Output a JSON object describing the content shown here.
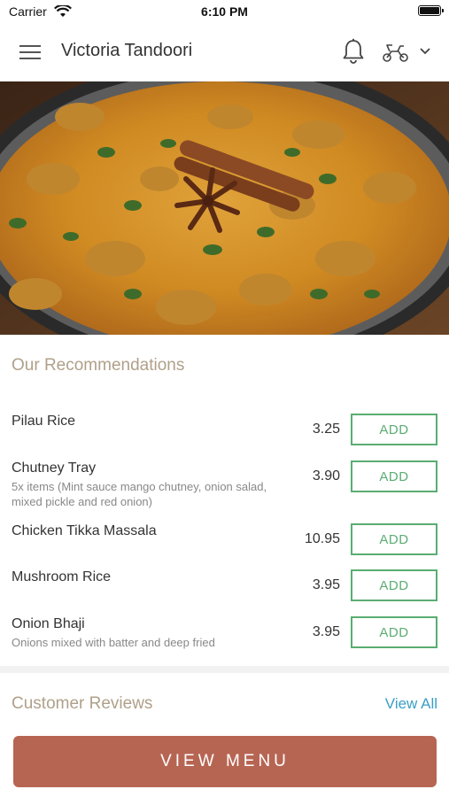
{
  "status_bar": {
    "carrier": "Carrier",
    "time": "6:10 PM"
  },
  "nav": {
    "title": "Victoria Tandoori"
  },
  "recommendations": {
    "title": "Our Recommendations",
    "add_label": "ADD",
    "items": [
      {
        "name": "Pilau Rice",
        "description": "",
        "price": "3.25"
      },
      {
        "name": "Chutney Tray",
        "description": "5x items (Mint sauce mango chutney, onion salad, mixed pickle and red onion)",
        "price": "3.90"
      },
      {
        "name": "Chicken Tikka Massala",
        "description": "",
        "price": "10.95"
      },
      {
        "name": "Mushroom Rice",
        "description": "",
        "price": "3.95"
      },
      {
        "name": "Onion Bhaji",
        "description": "Onions mixed with batter and deep fried",
        "price": "3.95"
      }
    ]
  },
  "reviews": {
    "title": "Customer Reviews",
    "view_all": "View All"
  },
  "cta": {
    "label": "VIEW MENU"
  },
  "colors": {
    "accent_green": "#5aad72",
    "cta": "#b76553",
    "section_title": "#b0a08a",
    "link": "#3a9fc6"
  },
  "icons": [
    "menu-icon",
    "bell-icon",
    "delivery-scooter-icon",
    "chevron-down-icon",
    "wifi-icon",
    "battery-icon"
  ]
}
